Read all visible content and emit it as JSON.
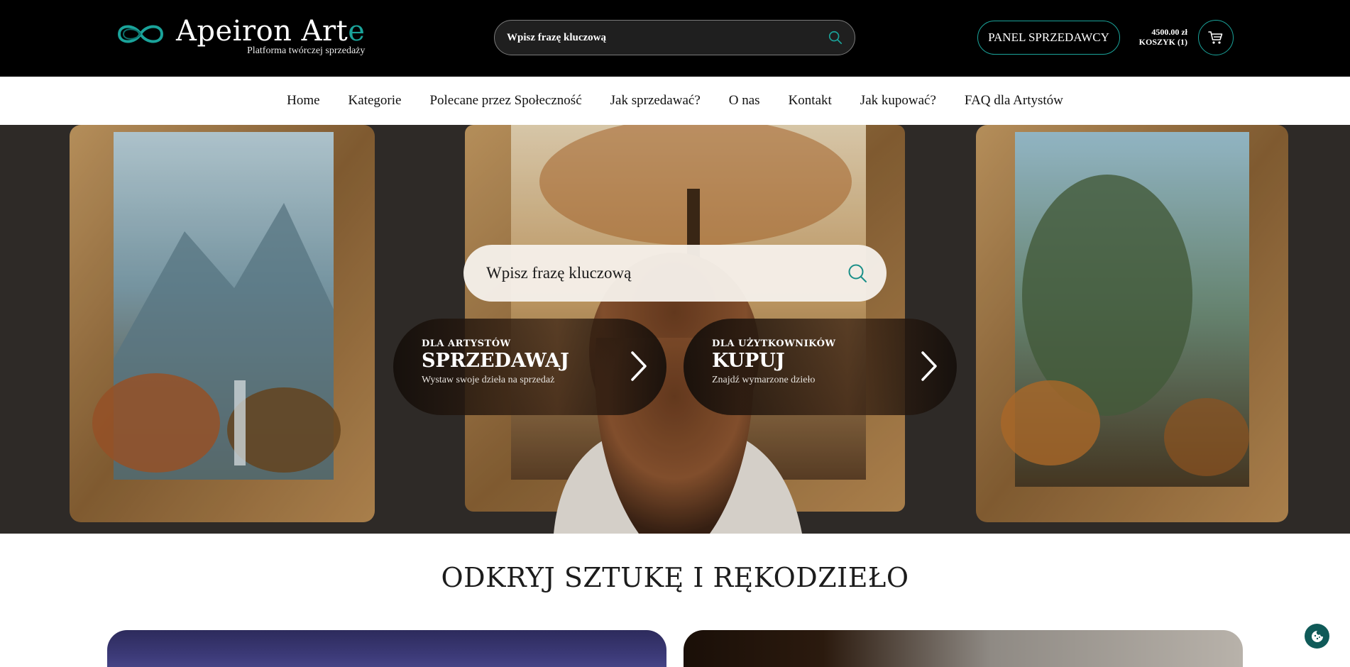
{
  "brand": {
    "name_main": "Apeiron Art",
    "name_accent": "e",
    "tagline": "Platforma twórczej sprzedaży"
  },
  "header": {
    "search_placeholder": "Wpisz frazę kluczową",
    "seller_panel_label": "PANEL SPRZEDAWCY",
    "cart_amount": "4500.00 zł",
    "cart_label": "KOSZYK (1)"
  },
  "nav": {
    "items": [
      {
        "label": "Home"
      },
      {
        "label": "Kategorie"
      },
      {
        "label": "Polecane przez Społeczność"
      },
      {
        "label": "Jak sprzedawać?"
      },
      {
        "label": "O nas"
      },
      {
        "label": "Kontakt"
      },
      {
        "label": "Jak kupować?"
      },
      {
        "label": "FAQ dla Artystów"
      }
    ]
  },
  "hero": {
    "search_placeholder": "Wpisz frazę kluczową",
    "cta_sell": {
      "small": "DLA ARTYSTÓW",
      "big": "SPRZEDAWAJ",
      "desc": "Wystaw swoje dzieła na sprzedaż"
    },
    "cta_buy": {
      "small": "DLA UŻYTKOWNIKÓW",
      "big": "KUPUJ",
      "desc": "Znajdź wymarzone dzieło"
    }
  },
  "section": {
    "title": "ODKRYJ SZTUKĘ I RĘKODZIEŁO"
  },
  "colors": {
    "accent": "#1aa39a",
    "header_bg": "#000000",
    "cookie_bg": "#0f5a58"
  },
  "icons": {
    "logo": "infinity-icon",
    "search": "search-icon",
    "cart": "cart-icon",
    "arrow": "chevron-right-icon",
    "cookie": "cookie-icon"
  }
}
